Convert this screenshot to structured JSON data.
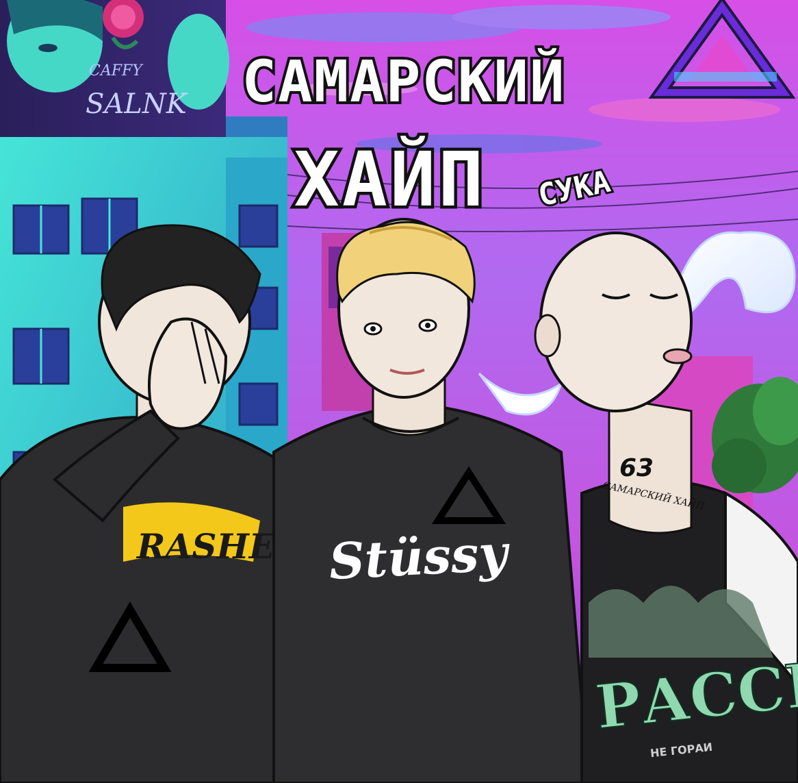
{
  "artwork": {
    "title_line1": "САМАРСКИЙ",
    "title_line2": "ХАЙП",
    "title_tag": "СУКА",
    "billboard_text_top": "CAFFY",
    "billboard_text_bottom": "SALNK",
    "neck_number": "63",
    "neck_script": "САМАРСКИЙ ХАЙП",
    "shirt_left_text": "RASHER",
    "shirt_middle_text": "Stüssy",
    "shirt_right_text": "РАССВЕТ",
    "shirt_right_small": "НЕ ГОРАИ"
  },
  "colors": {
    "sky_top": "#e34be0",
    "sky_mid": "#b46ae8",
    "building_teal": "#3fd8d0",
    "building_shadow": "#2a7fb8",
    "shirt_dark": "#2c2c2e",
    "skin": "#f1e6dc",
    "title_fill": "#ffffff",
    "title_outline": "#111111",
    "neon_purple": "#6a2bd8",
    "tree_green": "#2f7a3a"
  },
  "icons": {
    "logo_top_right": "palace-triangle-logo",
    "shirt_logo": "palace-triangle-logo"
  }
}
